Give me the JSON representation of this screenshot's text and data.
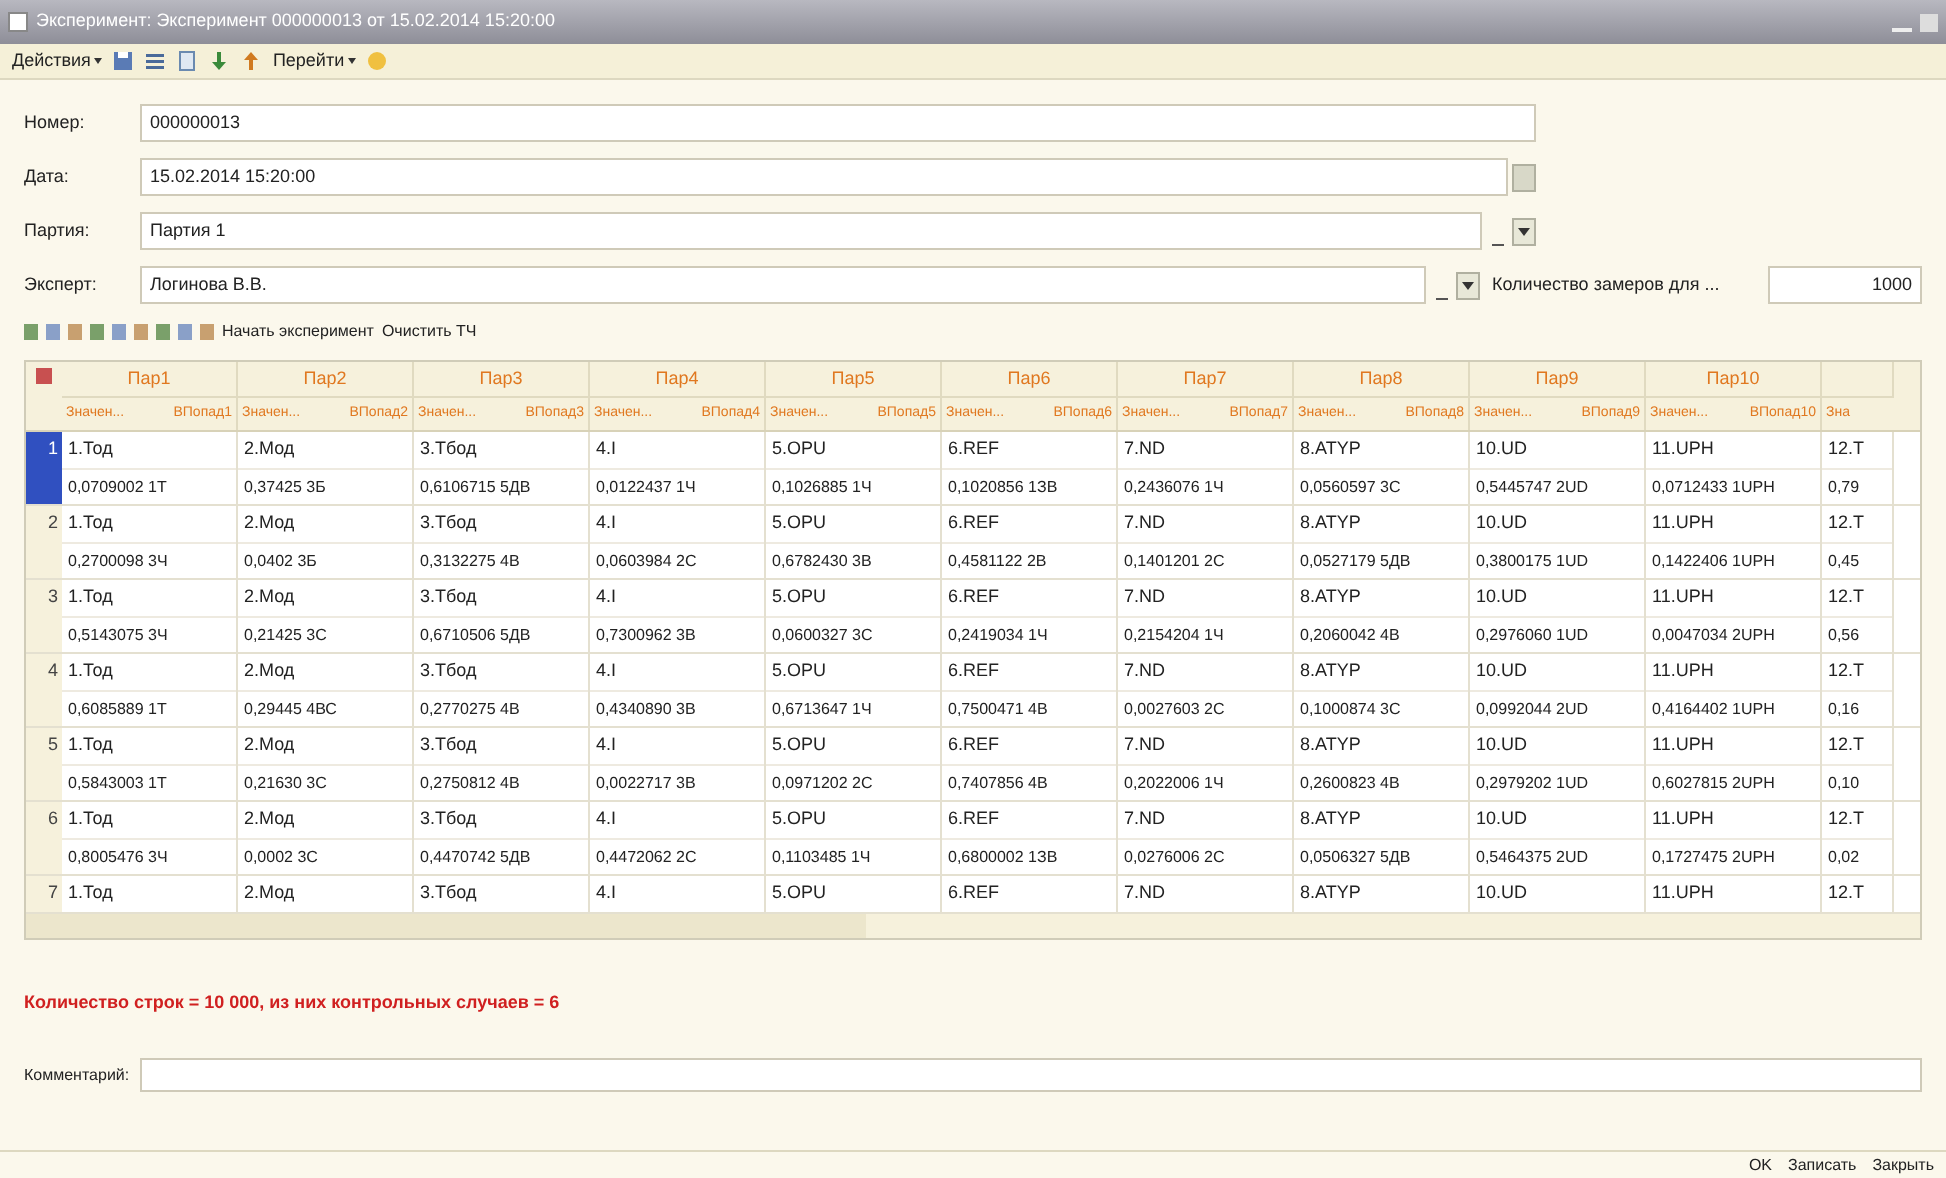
{
  "window": {
    "title": "Эксперимент: Эксперимент 000000013 от 15.02.2014 15:20:00"
  },
  "toolbar": [
    {
      "kind": "menu",
      "label": "Действия"
    },
    {
      "kind": "icon"
    },
    {
      "kind": "icon"
    },
    {
      "kind": "icon"
    },
    {
      "kind": "icon"
    },
    {
      "kind": "icon"
    },
    {
      "kind": "menu",
      "label": "Перейти"
    },
    {
      "kind": "icon"
    }
  ],
  "fields": [
    {
      "label": "Номер:",
      "value": "000000013",
      "kind": "text"
    },
    {
      "label": "Дата:",
      "value": "15.02.2014 15:20:00",
      "kind": "date"
    },
    {
      "label": "Партия:",
      "value": "Партия 1",
      "kind": "select"
    },
    {
      "label": "Эксперт:",
      "value": "Логинова В.В.",
      "kind": "select"
    }
  ],
  "measure_count": {
    "label": "Количество замеров для ...",
    "value": "1000"
  },
  "table_toolbar": {
    "start": "Начать эксперимент",
    "clear": "Очистить ТЧ"
  },
  "table": {
    "groups": [
      "Пар1",
      "Пар2",
      "Пар3",
      "Пар4",
      "Пар5",
      "Пар6",
      "Пар7",
      "Пар8",
      "Пар9",
      "Пар10"
    ],
    "subcolumns": [
      "Значен...",
      "ВПопад1",
      "Значен...",
      "ВПопад2",
      "Значен...",
      "ВПопад3",
      "Значен...",
      "ВПопад4",
      "Значен...",
      "ВПопад5",
      "Значен...",
      "ВПопад6",
      "Значен...",
      "ВПопад7",
      "Значен...",
      "ВПопад8",
      "Значен...",
      "ВПопад9",
      "Значен...",
      "ВПопад10",
      "Зна"
    ],
    "rows": [
      {
        "number": "1",
        "selected": true,
        "names": [
          "1.Тод",
          "2.Мод",
          "3.Тбод",
          "4.І",
          "5.ОРU",
          "6.REF",
          "7.ND",
          "8.ATYP",
          "10.UD",
          "11.UPH",
          "12.Т"
        ],
        "values": [
          "0,0709002 1Т",
          "0,37425 3Б",
          "0,6106715 5ДВ",
          "0,0122437 1Ч",
          "0,1026885 1Ч",
          "0,1020856 1ЗВ",
          "0,2436076 1Ч",
          "0,0560597 3С",
          "0,5445747 2UD",
          "0,0712433 1UPH",
          "0,79"
        ]
      },
      {
        "number": "2",
        "selected": false,
        "names": [
          "1.Тод",
          "2.Мод",
          "3.Тбод",
          "4.І",
          "5.ОРU",
          "6.REF",
          "7.ND",
          "8.ATYP",
          "10.UD",
          "11.UPH",
          "12.Т"
        ],
        "values": [
          "0,2700098 3Ч",
          "0,0402 3Б",
          "0,3132275 4В",
          "0,0603984 2С",
          "0,6782430 3В",
          "0,4581122 2В",
          "0,1401201 2С",
          "0,0527179 5ДВ",
          "0,3800175 1UD",
          "0,1422406 1UPH",
          "0,45"
        ]
      },
      {
        "number": "3",
        "selected": false,
        "names": [
          "1.Тод",
          "2.Мод",
          "3.Тбод",
          "4.І",
          "5.ОРU",
          "6.REF",
          "7.ND",
          "8.ATYP",
          "10.UD",
          "11.UPH",
          "12.Т"
        ],
        "values": [
          "0,5143075 3Ч",
          "0,21425 3С",
          "0,6710506 5ДВ",
          "0,7300962 3В",
          "0,0600327 3С",
          "0,2419034 1Ч",
          "0,2154204 1Ч",
          "0,2060042 4В",
          "0,2976060 1UD",
          "0,0047034 2UPH",
          "0,56"
        ]
      },
      {
        "number": "4",
        "selected": false,
        "names": [
          "1.Тод",
          "2.Мод",
          "3.Тбод",
          "4.І",
          "5.ОРU",
          "6.REF",
          "7.ND",
          "8.ATYP",
          "10.UD",
          "11.UPH",
          "12.Т"
        ],
        "values": [
          "0,6085889 1Т",
          "0,29445 4ВС",
          "0,2770275 4В",
          "0,4340890 3В",
          "0,6713647 1Ч",
          "0,7500471 4В",
          "0,0027603 2С",
          "0,1000874 3С",
          "0,0992044 2UD",
          "0,4164402 1UPH",
          "0,16"
        ]
      },
      {
        "number": "5",
        "selected": false,
        "names": [
          "1.Тод",
          "2.Мод",
          "3.Тбод",
          "4.І",
          "5.ОРU",
          "6.REF",
          "7.ND",
          "8.ATYP",
          "10.UD",
          "11.UPH",
          "12.Т"
        ],
        "values": [
          "0,5843003 1Т",
          "0,21630 3С",
          "0,2750812 4В",
          "0,0022717 3В",
          "0,0971202 2С",
          "0,7407856 4В",
          "0,2022006 1Ч",
          "0,2600823 4В",
          "0,2979202 1UD",
          "0,6027815 2UPH",
          "0,10"
        ]
      },
      {
        "number": "6",
        "selected": false,
        "names": [
          "1.Тод",
          "2.Мод",
          "3.Тбод",
          "4.І",
          "5.ОРU",
          "6.REF",
          "7.ND",
          "8.ATYP",
          "10.UD",
          "11.UPH",
          "12.Т"
        ],
        "values": [
          "0,8005476 3Ч",
          "0,0002 3С",
          "0,4470742 5ДВ",
          "0,4472062 2С",
          "0,1103485 1Ч",
          "0,6800002 1ЗВ",
          "0,0276006 2С",
          "0,0506327 5ДВ",
          "0,5464375 2UD",
          "0,1727475 2UPH",
          "0,02"
        ]
      },
      {
        "number": "7",
        "selected": false,
        "names": [
          "1.Тод",
          "2.Мод",
          "3.Тбод",
          "4.І",
          "5.ОРU",
          "6.REF",
          "7.ND",
          "8.ATYP",
          "10.UD",
          "11.UPH",
          "12.Т"
        ],
        "values": []
      }
    ]
  },
  "summary": "Количество строк = 10 000, из них контрольных случаев = 6",
  "comment": {
    "label": "Комментарий:"
  },
  "footer": {
    "ok": "OK",
    "save": "Записать",
    "close": "Закрыть"
  }
}
